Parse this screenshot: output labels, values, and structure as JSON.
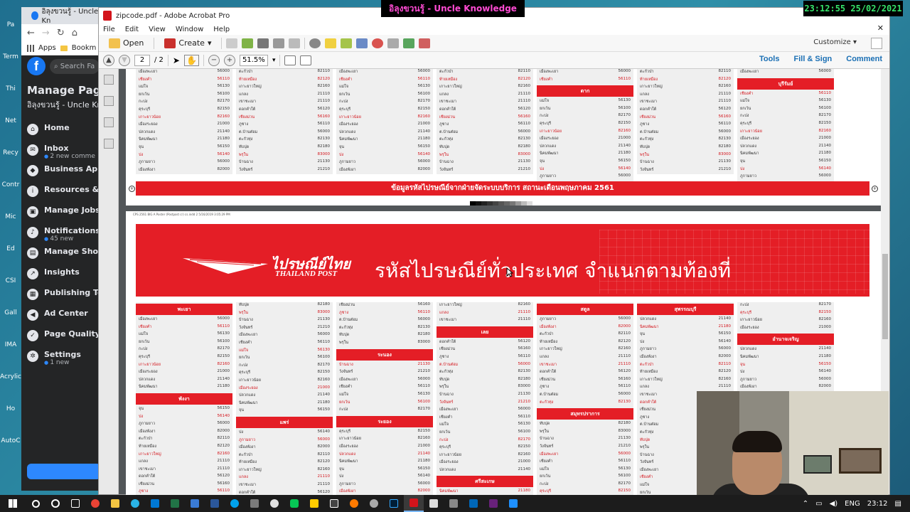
{
  "overlay": {
    "channel_title": "อิลุงขวนรู้ - Uncle Knowledge",
    "clock": "23:12:55 25/02/2021"
  },
  "desktop_icons": [
    "Pa",
    "Term",
    "Thi",
    "Net",
    "Recy",
    "Contr",
    "Mic",
    "Ed",
    "CSI",
    "Gall",
    "IMA",
    "Acrylic",
    "Ho",
    "AutoC"
  ],
  "facebook": {
    "tab_title": "อิลุงขวนรู้ - Uncle Kn",
    "bookmarks": [
      "Apps",
      "Bookm"
    ],
    "search_placeholder": "Search Fa",
    "page_title": "Manage Page",
    "page_name": "อิลุงขวนรู้ - Uncle Kno",
    "nav": [
      {
        "label": "Home",
        "sub": "",
        "icon": "home-icon",
        "glyph": "⌂"
      },
      {
        "label": "Inbox",
        "sub": "2 new comme",
        "icon": "inbox-icon",
        "glyph": "✉"
      },
      {
        "label": "Business App",
        "sub": "",
        "icon": "business-apps-icon",
        "glyph": "◆"
      },
      {
        "label": "Resources & T",
        "sub": "",
        "icon": "info-icon",
        "glyph": "i"
      },
      {
        "label": "Manage Jobs",
        "sub": "",
        "icon": "briefcase-icon",
        "glyph": "▣"
      },
      {
        "label": "Notifications",
        "sub": "45 new",
        "icon": "bell-icon",
        "glyph": "♪"
      },
      {
        "label": "Manage Shop",
        "sub": "",
        "icon": "shop-icon",
        "glyph": "▤"
      },
      {
        "label": "Insights",
        "sub": "",
        "icon": "insights-icon",
        "glyph": "↗"
      },
      {
        "label": "Publishing To",
        "sub": "",
        "icon": "publishing-icon",
        "glyph": "▦"
      },
      {
        "label": "Ad Center",
        "sub": "",
        "icon": "megaphone-icon",
        "glyph": "◀"
      },
      {
        "label": "Page Quality",
        "sub": "",
        "icon": "shield-icon",
        "glyph": "✓"
      },
      {
        "label": "Settings",
        "sub": "1 new",
        "icon": "gear-icon",
        "glyph": "✲"
      }
    ]
  },
  "acrobat": {
    "window_title": "zipcode.pdf - Adobe Acrobat Pro",
    "menu": [
      "File",
      "Edit",
      "View",
      "Window",
      "Help"
    ],
    "toolbar": {
      "open": "Open",
      "create": "Create",
      "customize": "Customize"
    },
    "nav": {
      "page": "2",
      "page_total": "/ 2",
      "zoom": "51.5%"
    },
    "right_tabs": [
      "Tools",
      "Fill & Sign",
      "Comment"
    ]
  },
  "pdf": {
    "page1_banner": "ข้อมูลรหัสไปรษณีย์จากฝ่ายจัดระบบบริการ สถานะเดือนพฤษภาคม 2561",
    "brand_th": "ไปรษณีย์ไทย",
    "brand_en": "THAILAND POST",
    "hero_title": "รหัสไปรษณีย์ทั่วประเทศ จำแนกตามท้องที่",
    "page2_slug": "CPS 2561 BIG A Poster (Postpost cr) cs.indd 2   5/16/2019   3:05:29 PM",
    "page1_headers": [
      {
        "col": 4,
        "after": 2,
        "label": "ตาก"
      },
      {
        "col": 6,
        "after": 1,
        "label": "บุรีรัมย์"
      }
    ],
    "page2_headers": [
      {
        "col": 0,
        "after": 0,
        "label": "พะเยา"
      },
      {
        "col": 0,
        "after": 10,
        "label": "พังงา"
      },
      {
        "col": 1,
        "after": 15,
        "label": "แพร่"
      },
      {
        "col": 2,
        "after": 6,
        "label": "ระนอง"
      },
      {
        "col": 2,
        "after": 13,
        "label": "ระยอง"
      },
      {
        "col": 3,
        "after": 3,
        "label": "เลย"
      },
      {
        "col": 3,
        "after": 21,
        "label": "ศรีสะเกษ"
      },
      {
        "col": 4,
        "after": 0,
        "label": "สตูล"
      },
      {
        "col": 4,
        "after": 12,
        "label": "สมุทรปราการ"
      },
      {
        "col": 4,
        "after": 23,
        "label": "สมุทรสงคราม"
      },
      {
        "col": 5,
        "after": 0,
        "label": "สุพรรณบุรี"
      },
      {
        "col": 6,
        "after": 4,
        "label": "อำนาจเจริญ"
      }
    ],
    "sample_rows": [
      [
        "เมืองพะเยา",
        "56000"
      ],
      [
        "ดอกคำใต้",
        "56120"
      ],
      [
        "จุน",
        "56150"
      ],
      [
        "เชียงคำ",
        "56110"
      ],
      [
        "เชียงม่วน",
        "56160"
      ],
      [
        "ปง",
        "56140"
      ],
      [
        "แม่ใจ",
        "56130"
      ],
      [
        "ภูซาง",
        "56110"
      ],
      [
        "ภูกามยาว",
        "56000"
      ],
      [
        "ยกเว้น",
        "56100"
      ],
      [
        "ต.บ้านต๋อม",
        "56000"
      ],
      [
        "เมืองพังงา",
        "82000"
      ],
      [
        "กะปง",
        "82170"
      ],
      [
        "ตะกั่วทุ่ง",
        "82130"
      ],
      [
        "ตะกั่วป่า",
        "82110"
      ],
      [
        "คุระบุรี",
        "82150"
      ],
      [
        "ทับปุด",
        "82180"
      ],
      [
        "ท้ายเหมือง",
        "82120"
      ],
      [
        "เกาะยาวน้อย",
        "82160"
      ],
      [
        "พรุใน",
        "83000"
      ],
      [
        "เกาะยาวใหญ่",
        "82160"
      ],
      [
        "เมืองระยอง",
        "21000"
      ],
      [
        "บ้านฉาง",
        "21130"
      ],
      [
        "แกลง",
        "21110"
      ],
      [
        "ปลวกแดง",
        "21140"
      ],
      [
        "วังจันทร์",
        "21210"
      ],
      [
        "เขาชะเมา",
        "21110"
      ],
      [
        "นิคมพัฒนา",
        "21180"
      ]
    ]
  },
  "taskbar": {
    "tray_lang": "ENG",
    "tray_time": "23:12",
    "tray_date": "25/02/2021"
  },
  "colors": {
    "thailand_post_red": "#e41e26",
    "facebook_blue": "#1877f2",
    "acrobat_link": "#1a6fb4"
  }
}
